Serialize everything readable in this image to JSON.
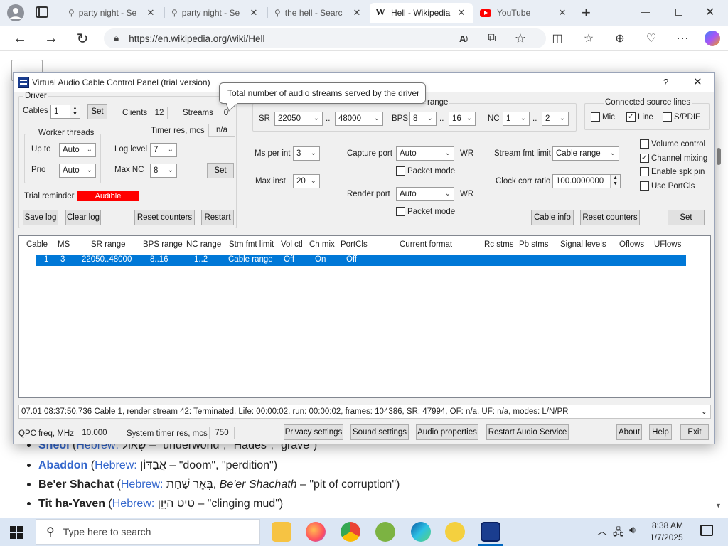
{
  "browser": {
    "tabs": [
      {
        "label": "party night - Se",
        "icon": "search-icon",
        "active": false
      },
      {
        "label": "party night - Se",
        "icon": "search-icon",
        "active": false
      },
      {
        "label": "the hell - Searc",
        "icon": "search-icon",
        "active": false
      },
      {
        "label": "Hell - Wikipedia",
        "icon": "wikipedia-icon",
        "icon_text": "W",
        "active": true
      },
      {
        "label": "YouTube",
        "icon": "youtube-icon",
        "active": false
      }
    ],
    "new_tab": "+",
    "url": "https://en.wikipedia.org/wiki/Hell"
  },
  "wiki": {
    "items": [
      {
        "term": "Sheol",
        "open": "(",
        "lang": "Hebrew:",
        "script": "שְׁאוֹל",
        "rest": " – \"underworld\", \"Hades\", \"grave\")"
      },
      {
        "term": "Abaddon",
        "open": "(",
        "lang": "Hebrew:",
        "script": "אֲבַדּוֹן",
        "rest": " – \"doom\", \"perdition\")"
      },
      {
        "term": "Be'er Shachat",
        "open": "(",
        "lang": "Hebrew:",
        "script": "בְּאֵר שַׁחַת",
        "mid": ", ",
        "ital": "Be'er Shachath",
        "rest": " – \"pit of corruption\")"
      },
      {
        "term": "Tit ha-Yaven",
        "open": "(",
        "lang": "Hebrew:",
        "script": "טִיט הַיָּוֵן",
        "rest": " – \"clinging mud\")"
      }
    ]
  },
  "dialog": {
    "title": "Virtual Audio Cable Control Panel (trial version)",
    "help": "?",
    "close": "✕",
    "driver": {
      "group": "Driver",
      "cables_label": "Cables",
      "cables_value": "1",
      "set": "Set",
      "clients_label": "Clients",
      "clients_value": "12",
      "streams_label": "Streams",
      "streams_value": "0",
      "worker_group": "Worker threads",
      "upto_label": "Up to",
      "upto_value": "Auto",
      "prio_label": "Prio",
      "prio_value": "Auto",
      "timer_label": "Timer res, mcs",
      "timer_value": "n/a",
      "loglevel_label": "Log level",
      "loglevel_value": "7",
      "maxnc_label": "Max NC",
      "maxnc_value": "8",
      "set2": "Set",
      "trial_label": "Trial reminder",
      "trial_value": "Audible",
      "save_log": "Save log",
      "clear_log": "Clear log",
      "reset_counters": "Reset counters",
      "restart": "Restart"
    },
    "cable": {
      "range_group": "range",
      "sr_label": "SR",
      "sr_min": "22050",
      "sr_max": "48000",
      "dots": "..",
      "bps_label": "BPS",
      "bps_min": "8",
      "bps_max": "16",
      "nc_label": "NC",
      "nc_min": "1",
      "nc_max": "2",
      "ms_label": "Ms per int",
      "ms_value": "3",
      "maxinst_label": "Max inst",
      "maxinst_value": "20",
      "capture_label": "Capture port",
      "capture_value": "Auto",
      "wr1": "WR",
      "packet1": "Packet mode",
      "render_label": "Render port",
      "render_value": "Auto",
      "wr2": "WR",
      "packet2": "Packet mode",
      "stream_fmt_label": "Stream fmt limit",
      "stream_fmt_value": "Cable range",
      "clock_label": "Clock corr ratio",
      "clock_value": "100.0000000",
      "cable_info": "Cable info",
      "reset_counters": "Reset counters",
      "set": "Set"
    },
    "source_lines": {
      "group": "Connected source lines",
      "mic": {
        "label": "Mic",
        "checked": false
      },
      "line": {
        "label": "Line",
        "checked": true
      },
      "spdif": {
        "label": "S/PDIF",
        "checked": false
      }
    },
    "options": [
      {
        "label": "Volume control",
        "checked": false
      },
      {
        "label": "Channel mixing",
        "checked": true
      },
      {
        "label": "Enable spk pin",
        "checked": false
      },
      {
        "label": "Use PortCls",
        "checked": false
      }
    ],
    "table": {
      "headers": [
        "Cable",
        "MS",
        "SR range",
        "BPS range",
        "NC range",
        "Stm fmt limit",
        "Vol ctl",
        "Ch mix",
        "PortCls",
        "Current format",
        "Rc stms",
        "Pb stms",
        "Signal levels",
        "Oflows",
        "UFlows"
      ],
      "rows": [
        [
          "1",
          "3",
          "22050..48000",
          "8..16",
          "1..2",
          "Cable range",
          "Off",
          "On",
          "Off",
          "",
          "",
          "",
          "",
          "",
          ""
        ]
      ]
    },
    "status_log": "07.01  08:37:50.736  Cable 1, render stream 42: Terminated. Life: 00:00:02, run: 00:00:02, frames: 104386, SR: 47994, OF: n/a, UF: n/a, modes: L/N/PR",
    "qpc_label": "QPC freq, MHz",
    "qpc_value": "10.000",
    "systimer_label": "System timer res, mcs",
    "systimer_value": "750",
    "bottom_buttons": [
      "Privacy settings",
      "Sound settings",
      "Audio properties",
      "Restart Audio Service",
      "About",
      "Help",
      "Exit"
    ],
    "tooltip": "Total number of audio streams served by the driver"
  },
  "taskbar": {
    "search_placeholder": "Type here to search",
    "time": "8:38 AM",
    "date": "1/7/2025"
  }
}
